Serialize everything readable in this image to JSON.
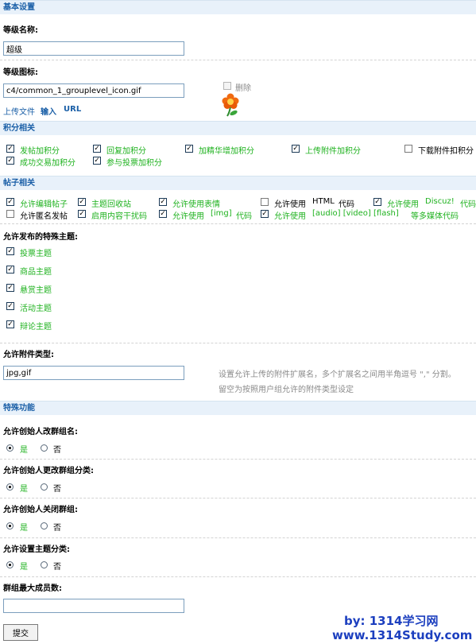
{
  "sections": {
    "basic": "基本设置",
    "credits": "积分相关",
    "posts": "帖子相关",
    "special": "特殊功能"
  },
  "level_name": {
    "label": "等级名称:",
    "value": "超级"
  },
  "level_icon": {
    "label": "等级图标:",
    "value": "c4/common_1_grouplevel_icon.gif",
    "delete_label": "删除",
    "upload_label": "上传文件",
    "input_label": "输入",
    "url_label": "URL"
  },
  "credits": {
    "items": [
      {
        "label": "发帖加积分",
        "checked": true
      },
      {
        "label": "回复加积分",
        "checked": true
      },
      {
        "label": "加精华增加积分",
        "checked": true
      },
      {
        "label": "上传附件加积分",
        "checked": true
      },
      {
        "label": "下载附件扣积分",
        "checked": false
      },
      {
        "label": "成功交易加积分",
        "checked": true
      },
      {
        "label": "参与投票加积分",
        "checked": true
      }
    ]
  },
  "posts": {
    "allow_edit": "允许编辑帖子",
    "recycle": "主题回收站",
    "smilies": "允许使用表情",
    "html_pre": "允许使用",
    "html_code": "HTML",
    "html_post": "代码",
    "discuz_pre": "允许使用",
    "discuz_code": "Discuz!",
    "discuz_post": "代码",
    "anonymous": "允许匿名发帖",
    "content_filter": "启用内容干扰码",
    "img_pre": "允许使用",
    "img_code": "[img]",
    "img_post": "代码",
    "media_pre": "允许使用",
    "media_code": "[audio] [video] [flash]",
    "media_post": "等多媒体代码"
  },
  "special_threads": {
    "label": "允许发布的特殊主题:",
    "items": [
      "投票主题",
      "商品主题",
      "悬赏主题",
      "活动主题",
      "辩论主题"
    ]
  },
  "attach_types": {
    "label": "允许附件类型:",
    "value": "jpg,gif",
    "hint1": "设置允许上传的附件扩展名，多个扩展名之间用半角逗号 \",\" 分割。",
    "hint2": "留空为按照用户组允许的附件类型设定"
  },
  "special_features": {
    "yes": "是",
    "no": "否",
    "items": [
      {
        "label": "允许创始人改群组名:",
        "selected": "yes"
      },
      {
        "label": "允许创始人更改群组分类:",
        "selected": "yes"
      },
      {
        "label": "允许创始人关闭群组:",
        "selected": "yes"
      },
      {
        "label": "允许设置主题分类:",
        "selected": "yes"
      }
    ]
  },
  "max_members": {
    "label": "群组最大成员数:",
    "value": ""
  },
  "submit_label": "提交",
  "watermark": {
    "line1": "by:  1314学习网",
    "line2": "www.1314Study.com"
  },
  "colors": {
    "accent": "#1a5fa7",
    "green": "#1fb21f",
    "section_bg": "#e8f1fa",
    "watermark": "#1c3fbf"
  }
}
